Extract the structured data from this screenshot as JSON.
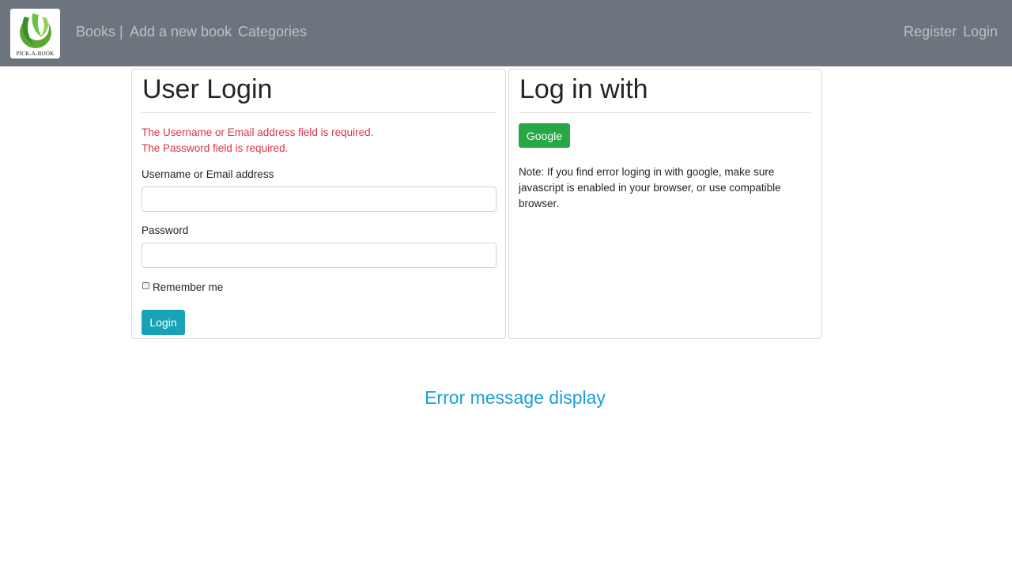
{
  "nav": {
    "logo_text": "PICK-A-BOOK",
    "links": [
      {
        "label": "Books |"
      },
      {
        "label": "Add a new book"
      },
      {
        "label": "Categories"
      }
    ],
    "right_links": [
      {
        "label": "Register"
      },
      {
        "label": "Login"
      }
    ]
  },
  "login_card": {
    "title": "User Login",
    "errors": [
      "The Username or Email address field is required.",
      "The Password field is required."
    ],
    "username_label": "Username or Email address",
    "username_value": "",
    "password_label": "Password",
    "password_value": "",
    "remember_label": "Remember me",
    "remember_checked": false,
    "submit_label": "Login"
  },
  "external_card": {
    "title": "Log in with",
    "google_label": "Google",
    "note": "Note: If you find error loging in with google, make sure javascript is enabled in your browser, or use compatible browser."
  },
  "footer_message": "Error message display",
  "colors": {
    "navbar": "#6c757d",
    "error": "#dc3545",
    "login_button": "#17a2b8",
    "google_button": "#28a745",
    "footer_text": "#1a9fd6"
  }
}
